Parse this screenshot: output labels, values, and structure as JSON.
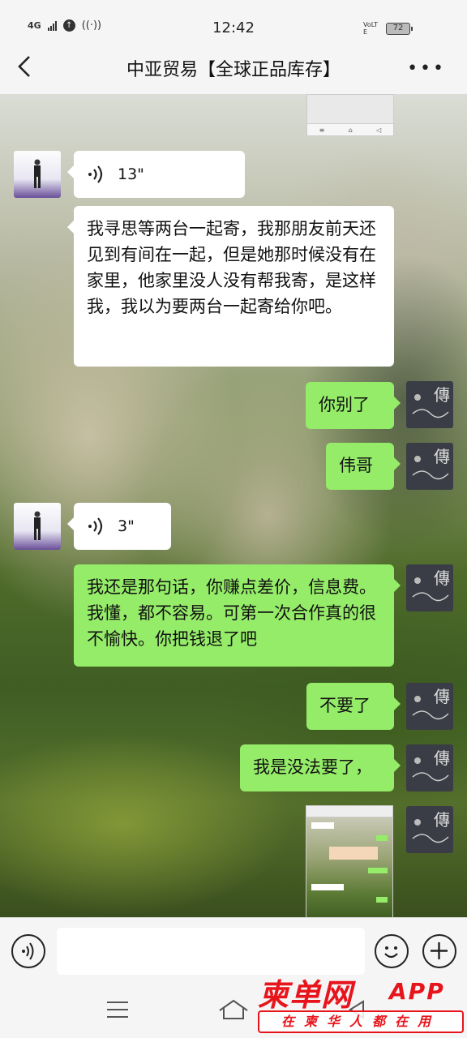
{
  "status_bar": {
    "network": "4G",
    "time": "12:42",
    "volte": "VoLTE",
    "battery": "72"
  },
  "nav": {
    "title": "中亚贸易【全球正品库存】"
  },
  "messages": [
    {
      "side": "left",
      "type": "voice",
      "duration": "13\""
    },
    {
      "side": "left",
      "type": "text",
      "text": "我寻思等两台一起寄，我那朋友前天还见到有间在一起，但是她那时候没有在家里，他家里没人没有帮我寄，是这样我，我以为要两台一起寄给你吧。"
    },
    {
      "side": "right",
      "type": "text",
      "text": "你别了"
    },
    {
      "side": "right",
      "type": "text",
      "text": "伟哥"
    },
    {
      "side": "left",
      "type": "voice",
      "duration": "3\""
    },
    {
      "side": "right",
      "type": "text",
      "text": "我还是那句话，你赚点差价，信息费。我懂，都不容易。可第一次合作真的很不愉快。你把钱退了吧"
    },
    {
      "side": "right",
      "type": "text",
      "text": "不要了"
    },
    {
      "side": "right",
      "type": "text",
      "text": "我是没法要了，"
    },
    {
      "side": "right",
      "type": "image",
      "text": "screenshot"
    }
  ],
  "input_bar": {
    "placeholder": ""
  },
  "watermark": {
    "title": "柬单网",
    "app": "APP",
    "slogan": "在柬华人都在用"
  },
  "icons": {
    "back": "chevron-left-icon",
    "more": "more-dots-icon",
    "voice": "voice-icon",
    "emoji": "emoji-icon",
    "plus": "plus-icon"
  }
}
